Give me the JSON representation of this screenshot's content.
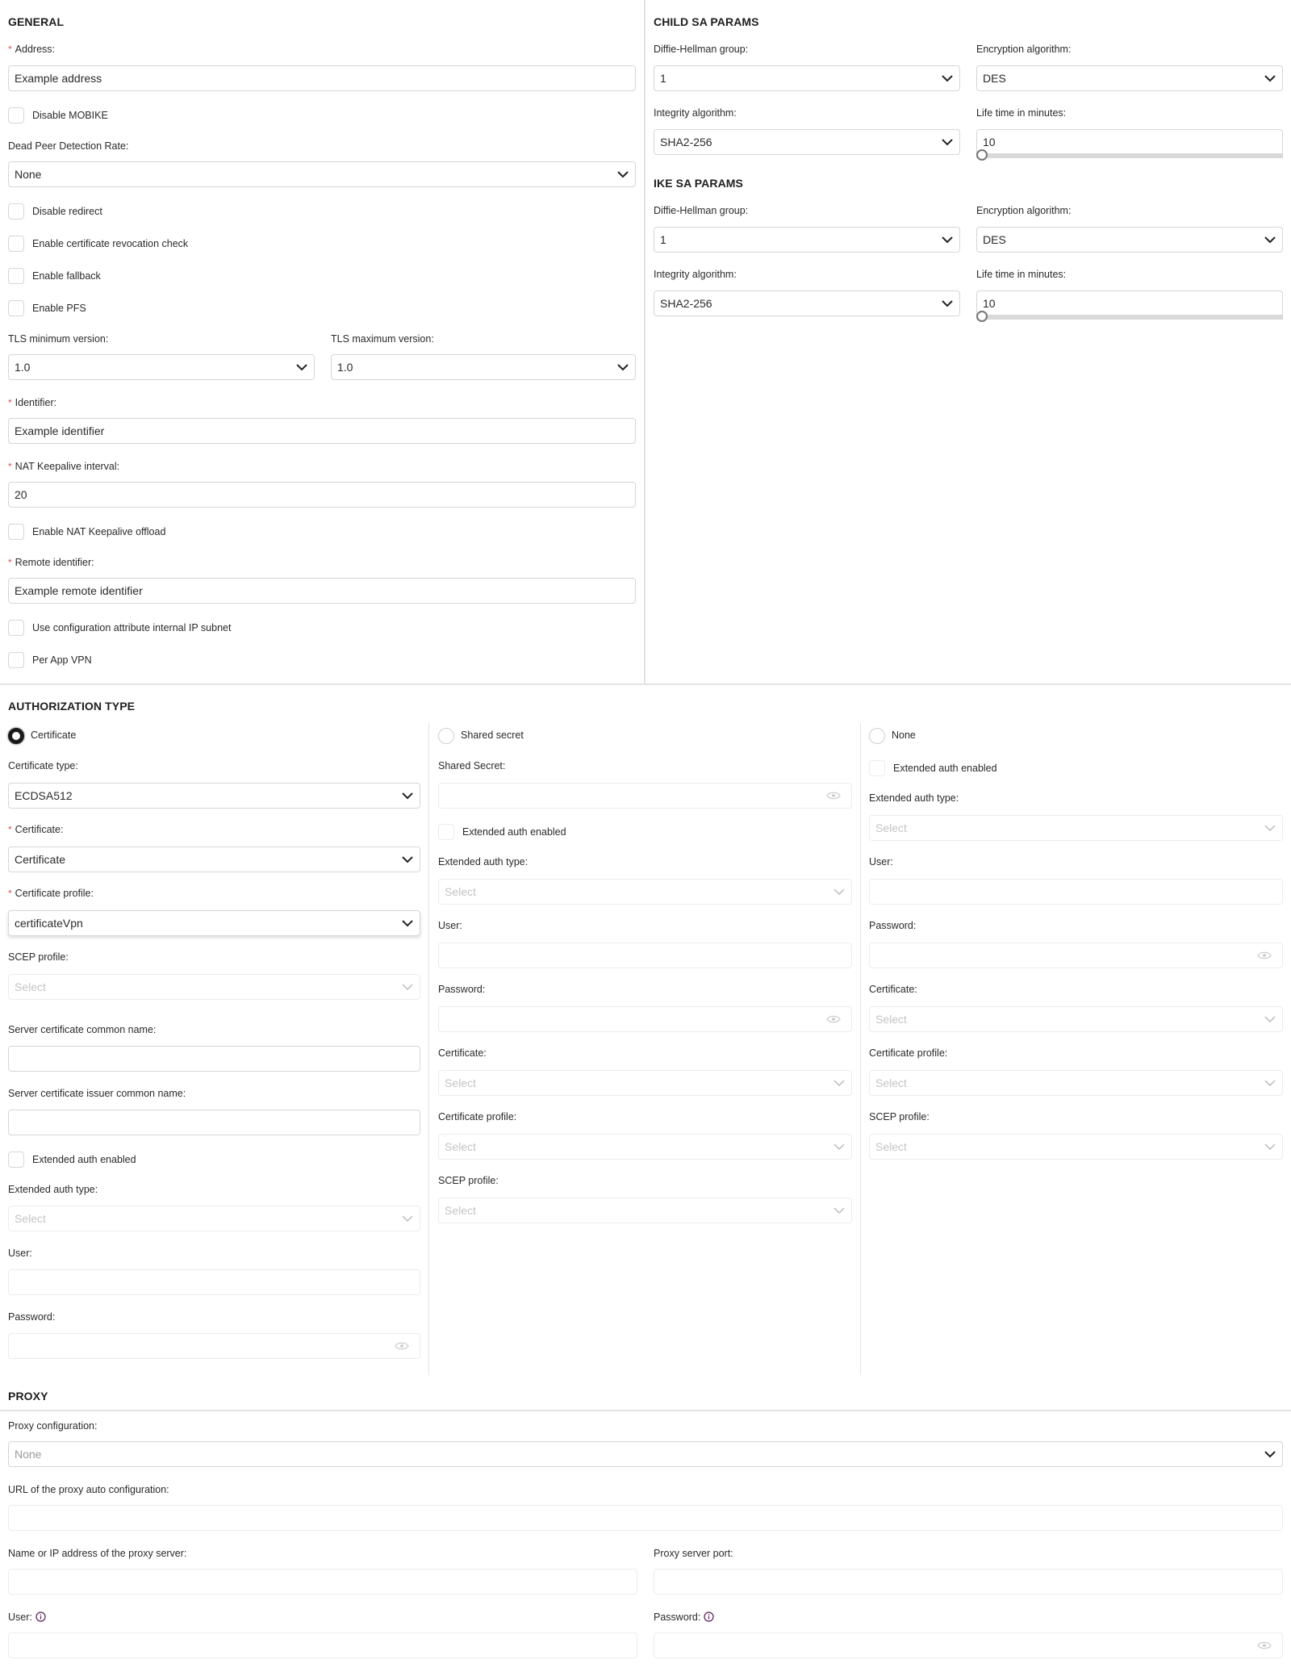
{
  "general": {
    "title": "GENERAL",
    "address": {
      "label": "Address:",
      "required": "*",
      "value": "Example address"
    },
    "disable_mobike": {
      "label": "Disable MOBIKE",
      "checked": false
    },
    "dpd_rate": {
      "label": "Dead Peer Detection Rate:",
      "value": "None"
    },
    "disable_redirect": {
      "label": "Disable redirect",
      "checked": false
    },
    "cert_revocation": {
      "label": "Enable certificate revocation check",
      "checked": false
    },
    "enable_fallback": {
      "label": "Enable fallback",
      "checked": false
    },
    "enable_pfs": {
      "label": "Enable PFS",
      "checked": false
    },
    "tls_min": {
      "label": "TLS minimum version:",
      "value": "1.0"
    },
    "tls_max": {
      "label": "TLS maximum version:",
      "value": "1.0"
    },
    "identifier": {
      "label": "Identifier:",
      "required": "*",
      "value": "Example identifier"
    },
    "nat_keepalive": {
      "label": "NAT Keepalive interval:",
      "required": "*",
      "value": "20"
    },
    "nat_offload": {
      "label": "Enable NAT Keepalive offload",
      "checked": false
    },
    "remote_identifier": {
      "label": "Remote identifier:",
      "required": "*",
      "value": "Example remote identifier"
    },
    "internal_ip_subnet": {
      "label": "Use configuration attribute internal IP subnet",
      "checked": false
    },
    "per_app_vpn": {
      "label": "Per App VPN",
      "checked": false
    }
  },
  "child_sa": {
    "title": "CHILD SA PARAMS",
    "dh_group": {
      "label": "Diffie-Hellman group:",
      "value": "1"
    },
    "encryption": {
      "label": "Encryption algorithm:",
      "value": "DES"
    },
    "integrity": {
      "label": "Integrity algorithm:",
      "value": "SHA2-256"
    },
    "lifetime": {
      "label": "Life time in minutes:",
      "value": "10",
      "slider_fraction": 0
    }
  },
  "ike_sa": {
    "title": "IKE SA PARAMS",
    "dh_group": {
      "label": "Diffie-Hellman group:",
      "value": "1"
    },
    "encryption": {
      "label": "Encryption algorithm:",
      "value": "DES"
    },
    "integrity": {
      "label": "Integrity algorithm:",
      "value": "SHA2-256"
    },
    "lifetime": {
      "label": "Life time in minutes:",
      "value": "10",
      "slider_fraction": 0
    }
  },
  "auth": {
    "title": "AUTHORIZATION TYPE",
    "certificate": {
      "radio_label": "Certificate",
      "selected": true,
      "cert_type": {
        "label": "Certificate type:",
        "value": "ECDSA512"
      },
      "certificate": {
        "label": "Certificate:",
        "required": "*",
        "value": "Certificate"
      },
      "cert_profile": {
        "label": "Certificate profile:",
        "required": "*",
        "value": "certificateVpn"
      },
      "scep_profile": {
        "label": "SCEP profile:",
        "placeholder": "Select"
      },
      "server_cn": {
        "label": "Server certificate common name:",
        "value": ""
      },
      "server_issuer_cn": {
        "label": "Server certificate issuer common name:",
        "value": ""
      },
      "ext_auth_enabled": {
        "label": "Extended auth enabled",
        "checked": false
      },
      "ext_auth_type": {
        "label": "Extended auth type:",
        "placeholder": "Select"
      },
      "user": {
        "label": "User:",
        "value": ""
      },
      "password": {
        "label": "Password:",
        "value": ""
      }
    },
    "shared_secret": {
      "radio_label": "Shared secret",
      "selected": false,
      "secret": {
        "label": "Shared Secret:",
        "value": ""
      },
      "ext_auth_enabled": {
        "label": "Extended auth enabled",
        "checked": false
      },
      "ext_auth_type": {
        "label": "Extended auth type:",
        "placeholder": "Select"
      },
      "user": {
        "label": "User:",
        "value": ""
      },
      "password": {
        "label": "Password:",
        "value": ""
      },
      "certificate": {
        "label": "Certificate:",
        "placeholder": "Select"
      },
      "cert_profile": {
        "label": "Certificate profile:",
        "placeholder": "Select"
      },
      "scep_profile": {
        "label": "SCEP profile:",
        "placeholder": "Select"
      }
    },
    "none": {
      "radio_label": "None",
      "selected": false,
      "ext_auth_enabled": {
        "label": "Extended auth enabled",
        "checked": false
      },
      "ext_auth_type": {
        "label": "Extended auth type:",
        "placeholder": "Select"
      },
      "user": {
        "label": "User:",
        "value": ""
      },
      "password": {
        "label": "Password:",
        "value": ""
      },
      "certificate": {
        "label": "Certificate:",
        "placeholder": "Select"
      },
      "cert_profile": {
        "label": "Certificate profile:",
        "placeholder": "Select"
      },
      "scep_profile": {
        "label": "SCEP profile:",
        "placeholder": "Select"
      }
    }
  },
  "proxy": {
    "title": "PROXY",
    "configuration": {
      "label": "Proxy configuration:",
      "value": "None"
    },
    "pac_url": {
      "label": "URL of the proxy auto configuration:",
      "value": ""
    },
    "server": {
      "label": "Name or IP address of the proxy server:",
      "value": ""
    },
    "port": {
      "label": "Proxy server port:",
      "value": ""
    },
    "user": {
      "label": "User:",
      "value": ""
    },
    "password": {
      "label": "Password:",
      "value": ""
    }
  },
  "colors": {
    "required": "#d9534f",
    "info_icon": "#5b1a5e",
    "border": "#d6d6d6",
    "divider": "#e3e3e3"
  }
}
